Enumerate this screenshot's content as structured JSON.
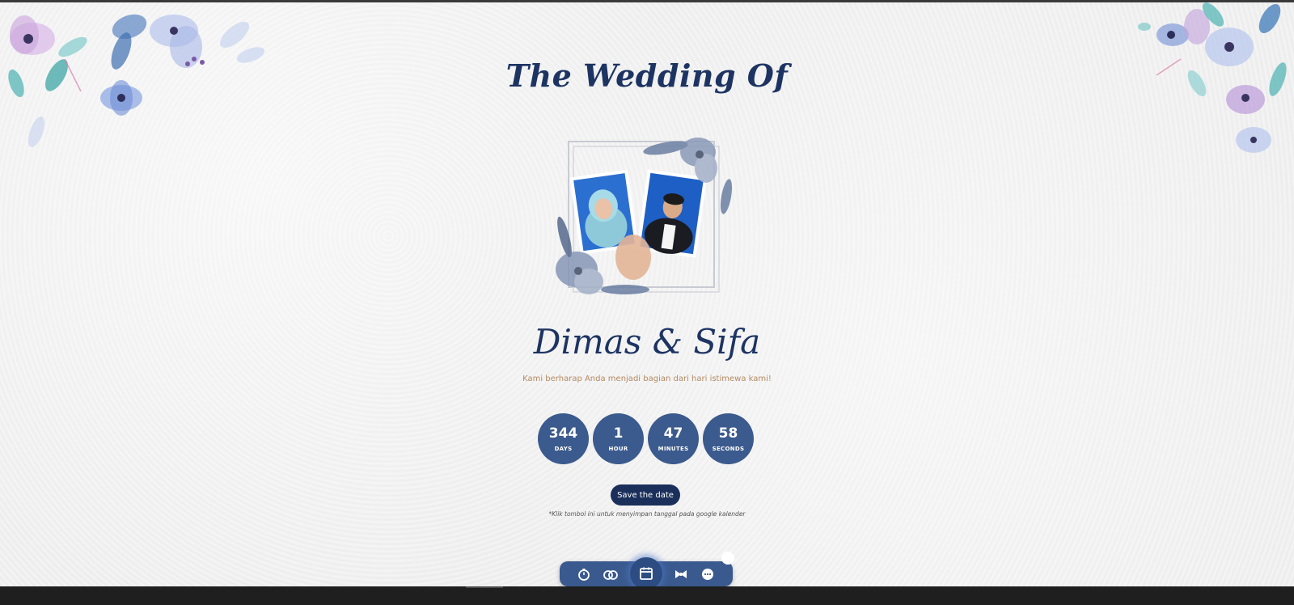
{
  "header": {
    "title": "The Wedding Of"
  },
  "couple": {
    "names": "Dimas & Sifa",
    "tagline": "Kami berharap Anda menjadi bagian dari hari istimewa kami!"
  },
  "countdown": [
    {
      "value": "344",
      "label": "DAYS"
    },
    {
      "value": "1",
      "label": "HOUR"
    },
    {
      "value": "47",
      "label": "MINUTES"
    },
    {
      "value": "58",
      "label": "SECONDS"
    }
  ],
  "save_date": {
    "label": "Save the date",
    "note": "*Klik tombol ini untuk menyimpan tanggal pada google kalender"
  },
  "nav": {
    "icons": [
      "stopwatch-icon",
      "rings-icon",
      "calendar-icon",
      "bow-icon",
      "chat-icon"
    ],
    "active": "calendar-icon"
  },
  "colors": {
    "accent": "#1d3463",
    "circle": "#3b5a8d",
    "button": "#1b2f5b",
    "tagline": "#b58a62",
    "nav": "#3a5a8f"
  }
}
